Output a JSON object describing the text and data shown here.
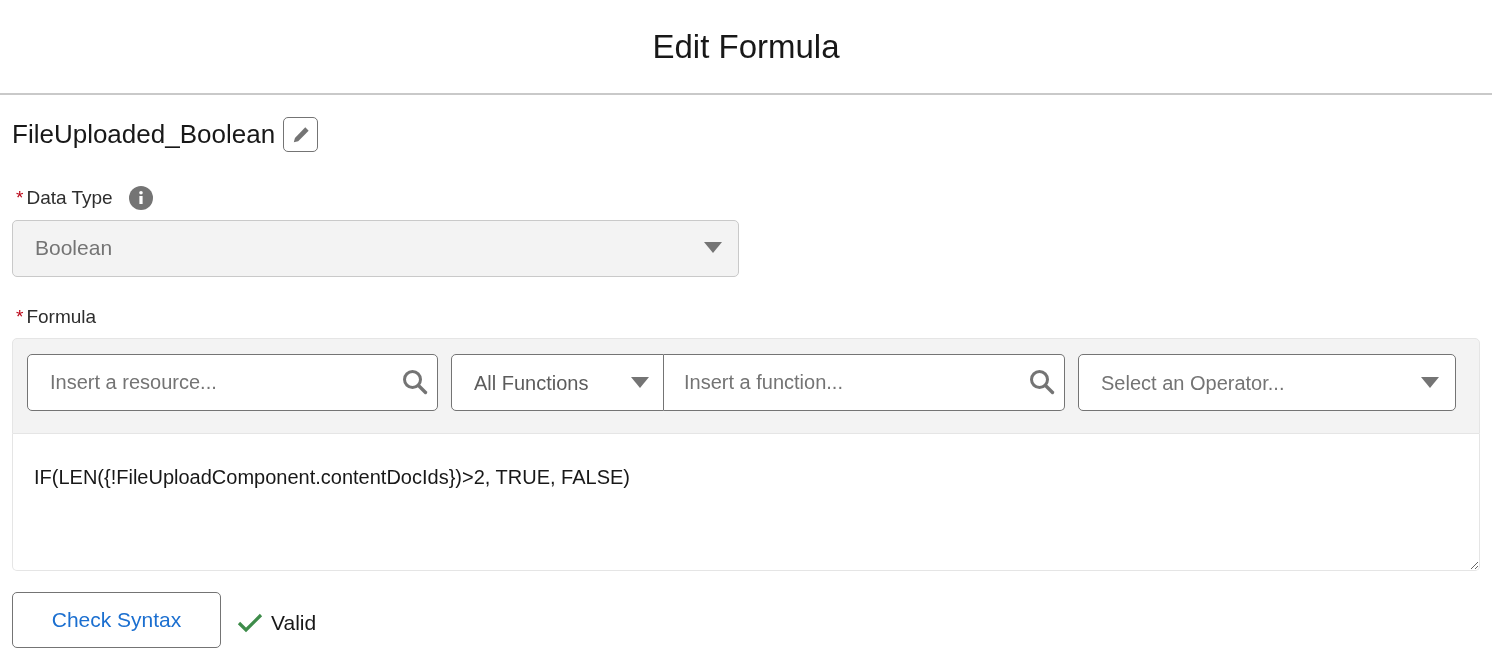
{
  "header": {
    "title": "Edit Formula"
  },
  "resource_name": "FileUploaded_Boolean",
  "data_type": {
    "required_mark": "*",
    "label": "Data Type",
    "value": "Boolean",
    "disabled": true
  },
  "formula": {
    "required_mark": "*",
    "label": "Formula",
    "resource_search": {
      "placeholder": "Insert a resource..."
    },
    "function_category": "All Functions",
    "function_search": {
      "placeholder": "Insert a function..."
    },
    "operator_select": {
      "placeholder": "Select an Operator..."
    },
    "expression": "IF(LEN({!FileUploadComponent.contentDocIds})>2, TRUE, FALSE)"
  },
  "check_button": "Check Syntax",
  "syntax_status": {
    "text": "Valid",
    "valid": true
  }
}
